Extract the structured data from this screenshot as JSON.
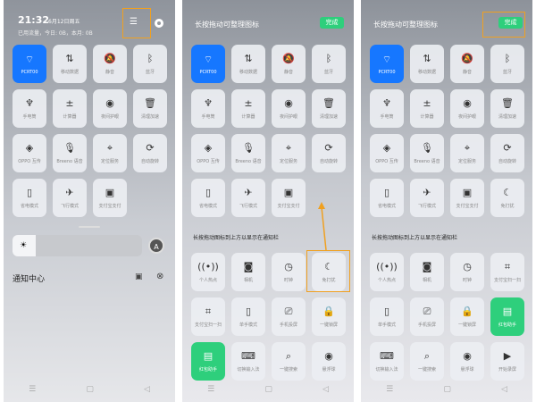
{
  "status": {
    "time": "21:32",
    "date": "6月12日周五",
    "usage": "已用流量，今日: 0B，本月: 0B"
  },
  "panel1": {
    "brightness": 0.05,
    "auto_label": "A",
    "notification_center": "通知中心"
  },
  "edit": {
    "title": "长按拖动可整理图标",
    "done": "完成",
    "section": "长按拖动图标到上方以显示在通知栏"
  },
  "colors": {
    "blue": "#1677ff",
    "green": "#2ecf7c",
    "highlight": "#f0a020"
  },
  "active_tiles": [
    {
      "label": "PCRT00",
      "icon": "wifi-icon",
      "ic": "⌔"
    },
    {
      "label": "移动数据",
      "icon": "mobile-data-icon",
      "ic": "⇅"
    },
    {
      "label": "静音",
      "icon": "mute-icon",
      "ic": "🔕"
    },
    {
      "label": "蓝牙",
      "icon": "bluetooth-icon",
      "ic": "ᛒ"
    },
    {
      "label": "手电筒",
      "icon": "flashlight-icon",
      "ic": "♆"
    },
    {
      "label": "计算器",
      "icon": "calculator-icon",
      "ic": "±"
    },
    {
      "label": "夜间护眼",
      "icon": "eye-icon",
      "ic": "◉"
    },
    {
      "label": "清理加速",
      "icon": "trash-icon",
      "ic": "🗑"
    },
    {
      "label": "OPPO 互传",
      "icon": "share-icon",
      "ic": "◈"
    },
    {
      "label": "Breeno 语音",
      "icon": "mic-icon",
      "ic": "🎙"
    },
    {
      "label": "定位服务",
      "icon": "location-icon",
      "ic": "⌖"
    },
    {
      "label": "自动旋转",
      "icon": "rotate-icon",
      "ic": "⟳"
    },
    {
      "label": "省电模式",
      "icon": "battery-icon",
      "ic": "▯"
    },
    {
      "label": "飞行模式",
      "icon": "airplane-icon",
      "ic": "✈"
    },
    {
      "label": "支付宝支付",
      "icon": "pay-icon",
      "ic": "▣"
    }
  ],
  "dnd_tile": {
    "label": "免打扰",
    "icon": "moon-icon",
    "ic": "☾"
  },
  "available_p2": [
    {
      "label": "个人热点",
      "icon": "hotspot-icon",
      "ic": "((•))"
    },
    {
      "label": "相机",
      "icon": "camera-icon",
      "ic": "◙"
    },
    {
      "label": "时钟",
      "icon": "clock-icon",
      "ic": "◷"
    },
    {
      "label": "免打扰",
      "icon": "moon-icon",
      "ic": "☾"
    },
    {
      "label": "支付宝扫一扫",
      "icon": "scan-icon",
      "ic": "⌗"
    },
    {
      "label": "单手模式",
      "icon": "phone-icon",
      "ic": "▯"
    },
    {
      "label": "手机投屏",
      "icon": "cast-icon",
      "ic": "⎚"
    },
    {
      "label": "一键锁屏",
      "icon": "lock-icon",
      "ic": "🔒"
    },
    {
      "label": "红包助手",
      "icon": "envelope-icon",
      "ic": "▤",
      "green": true
    },
    {
      "label": "切换输入法",
      "icon": "keyboard-icon",
      "ic": "⌨"
    },
    {
      "label": "一键搜索",
      "icon": "search-icon",
      "ic": "⌕"
    },
    {
      "label": "悬浮球",
      "icon": "float-ball-icon",
      "ic": "◉"
    }
  ],
  "available_p3": [
    {
      "label": "个人热点",
      "icon": "hotspot-icon",
      "ic": "((•))"
    },
    {
      "label": "相机",
      "icon": "camera-icon",
      "ic": "◙"
    },
    {
      "label": "时钟",
      "icon": "clock-icon",
      "ic": "◷"
    },
    {
      "label": "支付宝扫一扫",
      "icon": "scan-icon",
      "ic": "⌗"
    },
    {
      "label": "单手模式",
      "icon": "phone-icon",
      "ic": "▯"
    },
    {
      "label": "手机投屏",
      "icon": "cast-icon",
      "ic": "⎚"
    },
    {
      "label": "一键锁屏",
      "icon": "lock-icon",
      "ic": "🔒"
    },
    {
      "label": "红包助手",
      "icon": "envelope-icon",
      "ic": "▤",
      "green": true
    },
    {
      "label": "切换输入法",
      "icon": "keyboard-icon",
      "ic": "⌨"
    },
    {
      "label": "一键搜索",
      "icon": "search-icon",
      "ic": "⌕"
    },
    {
      "label": "悬浮球",
      "icon": "float-ball-icon",
      "ic": "◉"
    },
    {
      "label": "开始录屏",
      "icon": "record-icon",
      "ic": "▶"
    }
  ],
  "nav": {
    "menu": "☰",
    "home": "▢",
    "back": "◁"
  }
}
